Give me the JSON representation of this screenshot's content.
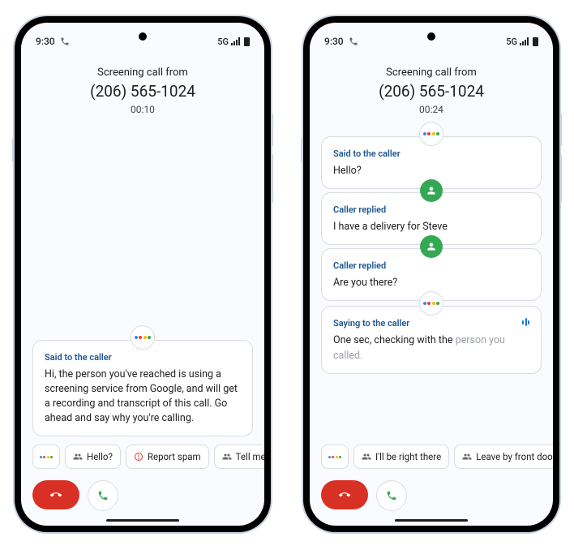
{
  "status": {
    "time": "9:30",
    "network": "5G"
  },
  "phone1": {
    "title": "Screening call from",
    "number": "(206) 565-1024",
    "timer": "00:10",
    "card1": {
      "label": "Said to the caller",
      "text": "Hi, the person you've reached is using a screening service from Google, and will get a recording and transcript of this call. Go ahead and say why you're calling."
    },
    "chips": {
      "c1": "Hello?",
      "c2": "Report spam",
      "c3": "Tell me mo"
    }
  },
  "phone2": {
    "title": "Screening call from",
    "number": "(206) 565-1024",
    "timer": "00:24",
    "card1": {
      "label": "Said to the caller",
      "text": "Hello?"
    },
    "card2": {
      "label": "Caller replied",
      "text": "I have a delivery for Steve"
    },
    "card3": {
      "label": "Caller replied",
      "text": "Are you there?"
    },
    "card4": {
      "label": "Saying to the caller",
      "text_a": "One sec, checking with the ",
      "text_b": "person you called."
    },
    "chips": {
      "c1": "I'll be right there",
      "c2": "Leave by front door"
    }
  }
}
